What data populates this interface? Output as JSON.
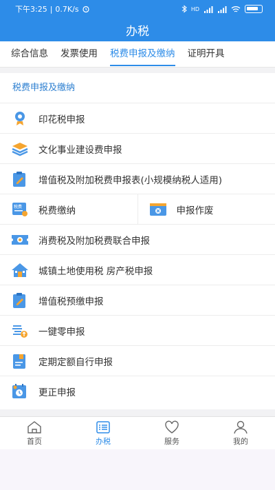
{
  "status_bar": {
    "time": "下午3:25",
    "speed": "0.7K/s",
    "signal": "HD"
  },
  "title": "办税",
  "tabs": [
    {
      "label": "综合信息"
    },
    {
      "label": "发票使用"
    },
    {
      "label": "税费申报及缴纳"
    },
    {
      "label": "证明开具"
    }
  ],
  "active_tab": 2,
  "section_title": "税费申报及缴纳",
  "items": {
    "stamp": "印花税申报",
    "culture": "文化事业建设费申报",
    "vat_small": "增值税及附加税费申报表(小规模纳税人适用)",
    "tax_payment": "税费缴纳",
    "void_declaration": "申报作废",
    "consumption": "消费税及附加税费联合申报",
    "land_property": "城镇土地使用税 房产税申报",
    "vat_prepay": "增值税预缴申报",
    "zero": "一键零申报",
    "fixed_quota": "定期定额自行申报",
    "correction": "更正申报"
  },
  "small_labels": {
    "tax_payment_icon_text": "税费"
  },
  "bottom_nav": [
    {
      "label": "首页"
    },
    {
      "label": "办税"
    },
    {
      "label": "服务"
    },
    {
      "label": "我的"
    }
  ],
  "colors": {
    "primary": "#2d8ce8",
    "icon_blue": "#4a97e6",
    "icon_orange": "#f5a530"
  }
}
